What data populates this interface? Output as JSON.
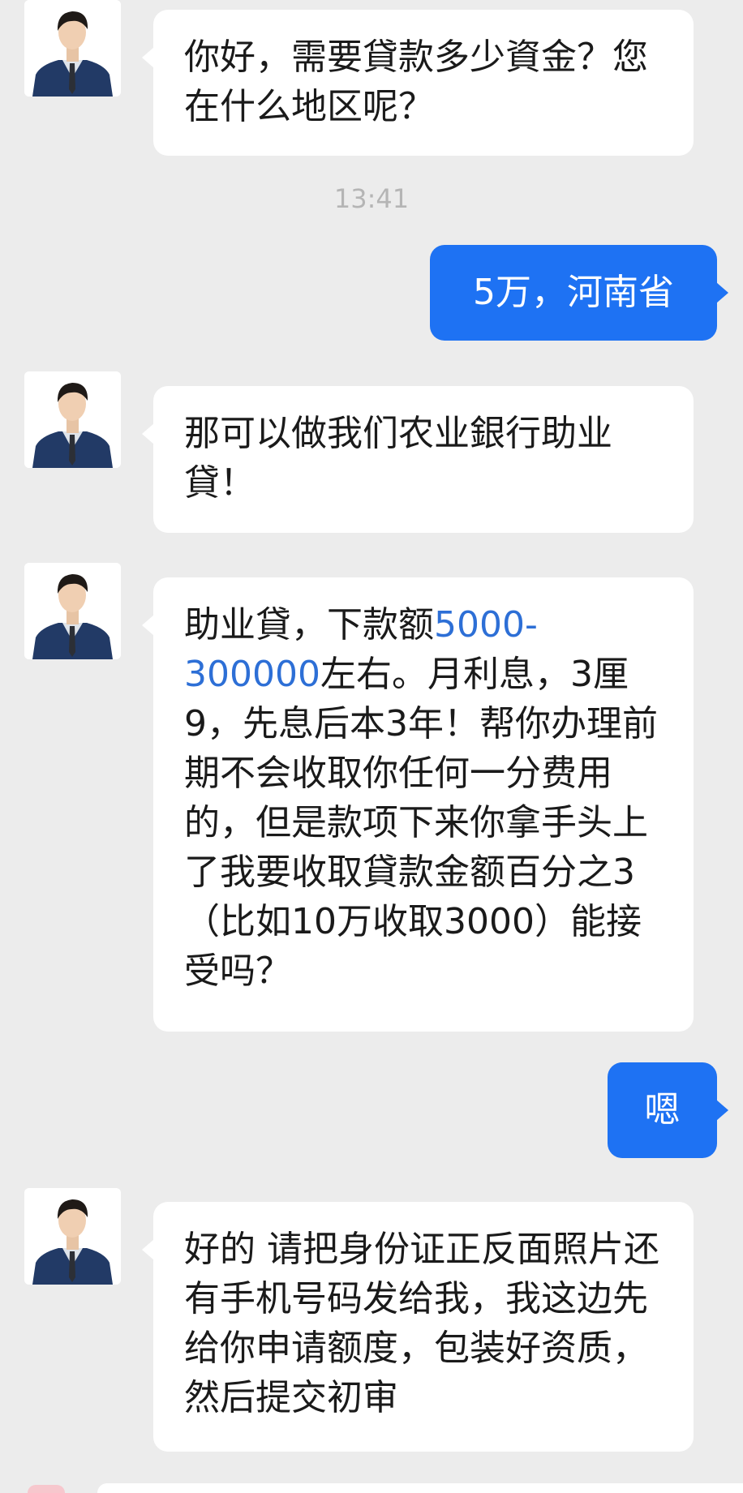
{
  "chat": {
    "timestamp": "13:41",
    "messages": [
      {
        "from": "contact",
        "text": "你好，需要貸款多少資金？您在什么地区呢？"
      },
      {
        "from": "me",
        "text": "5万，河南省"
      },
      {
        "from": "contact",
        "text": "那可以做我们农业銀行助业貸！"
      },
      {
        "from": "contact",
        "text_before": "助业貸，下款额",
        "link_text": "5000-300000",
        "text_after": "左右。月利息，3厘9，先息后本3年！帮你办理前期不会收取你任何一分费用的，但是款项下来你拿手头上了我要收取貸款金额百分之3（比如10万收取3000）能接受吗？"
      },
      {
        "from": "me",
        "text": "嗯"
      },
      {
        "from": "contact",
        "text": "好的 请把身份证正反面照片还有手机号码发给我，我这边先给你申请额度，包装好资质，然后提交初审"
      }
    ]
  },
  "colors": {
    "background": "#ececec",
    "incoming_bubble": "#ffffff",
    "outgoing_bubble": "#1e72f3",
    "link": "#2d6fd6",
    "timestamp": "#b5b5b5"
  }
}
